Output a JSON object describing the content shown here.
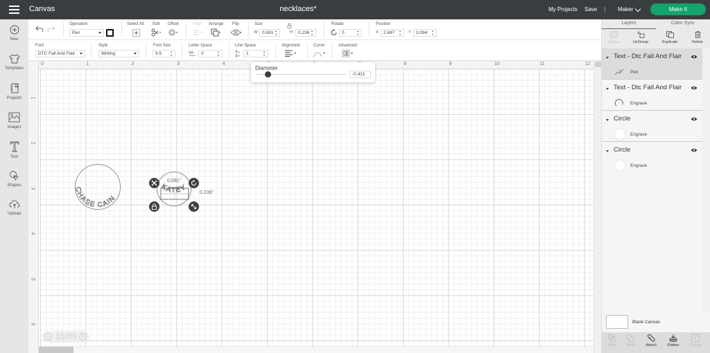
{
  "topbar": {
    "app_title": "Canvas",
    "doc_title": "necklaces*",
    "my_projects": "My Projects",
    "save": "Save",
    "separator": "|",
    "machine": "Maker",
    "make_it": "Make It",
    "make_it_color": "#14a36b"
  },
  "leftnav": {
    "items": [
      {
        "label": "New",
        "icon": "plus-circle-icon"
      },
      {
        "label": "Templates",
        "icon": "tshirt-icon"
      },
      {
        "label": "Projects",
        "icon": "notebook-icon"
      },
      {
        "label": "Images",
        "icon": "image-icon"
      },
      {
        "label": "Text",
        "icon": "text-icon"
      },
      {
        "label": "Shapes",
        "icon": "shapes-icon"
      },
      {
        "label": "Upload",
        "icon": "upload-icon"
      }
    ]
  },
  "toolbar": {
    "operation": {
      "label": "Operation",
      "value": "Pen"
    },
    "select_all": "Select All",
    "edit": "Edit",
    "offset": "Offset",
    "align": "Align",
    "arrange": "Arrange",
    "flip": "Flip",
    "size": {
      "label": "Size",
      "w_label": "W",
      "w": "0.591",
      "h_label": "H",
      "h": "0.236"
    },
    "rotate": {
      "label": "Rotate",
      "value": "0"
    },
    "position": {
      "label": "Position",
      "x_label": "X",
      "x": "2.697",
      "y_label": "Y",
      "y": "3.094"
    }
  },
  "text_toolbar": {
    "font": {
      "label": "Font",
      "value": "DTC Fall And Flair"
    },
    "style": {
      "label": "Style",
      "value": "Writing"
    },
    "font_size": {
      "label": "Font Size",
      "value": "9.5"
    },
    "letter_space": {
      "label": "Letter Space",
      "value": "0"
    },
    "line_space": {
      "label": "Line Space",
      "value": "1"
    },
    "alignment": "Alignment",
    "curve": "Curve",
    "advanced": "Advanced"
  },
  "curve_popover": {
    "label": "Diameter",
    "value": "-0.421"
  },
  "canvas": {
    "ruler_x": [
      "0",
      "1",
      "2",
      "3",
      "4",
      "5",
      "6",
      "7",
      "8",
      "9",
      "10",
      "11",
      "12"
    ],
    "ruler_y": [
      "1",
      "2",
      "3",
      "4",
      "5",
      "6"
    ],
    "zoom": "150%",
    "zoom_minus": "−",
    "zoom_plus": "+",
    "selection_width": "0.591\"",
    "selection_height": "0.236\"",
    "curved_text_1": "CHASE CAIN",
    "curved_text_2": "KATEY"
  },
  "right_panel": {
    "tabs": [
      "Layers",
      "Color Sync"
    ],
    "actions": [
      {
        "label": "Group",
        "enabled": false
      },
      {
        "label": "UnGroup",
        "enabled": true
      },
      {
        "label": "Duplicate",
        "enabled": true
      },
      {
        "label": "Delete",
        "enabled": true
      }
    ],
    "layers": [
      {
        "name": "Text - Dtc Fall And Flair",
        "operation": "Pen",
        "selected": true
      },
      {
        "name": "Text - Dtc Fall And Flair",
        "operation": "Engrave",
        "selected": false
      },
      {
        "name": "Circle",
        "operation": "Engrave",
        "selected": false
      },
      {
        "name": "Circle",
        "operation": "Engrave",
        "selected": false
      }
    ],
    "blank_canvas": "Blank Canvas",
    "bottom_actions": [
      {
        "label": "Slice",
        "enabled": false
      },
      {
        "label": "Weld",
        "enabled": false
      },
      {
        "label": "Attach",
        "enabled": true
      },
      {
        "label": "Flatten",
        "enabled": true
      },
      {
        "label": "Contour",
        "enabled": false
      }
    ]
  }
}
